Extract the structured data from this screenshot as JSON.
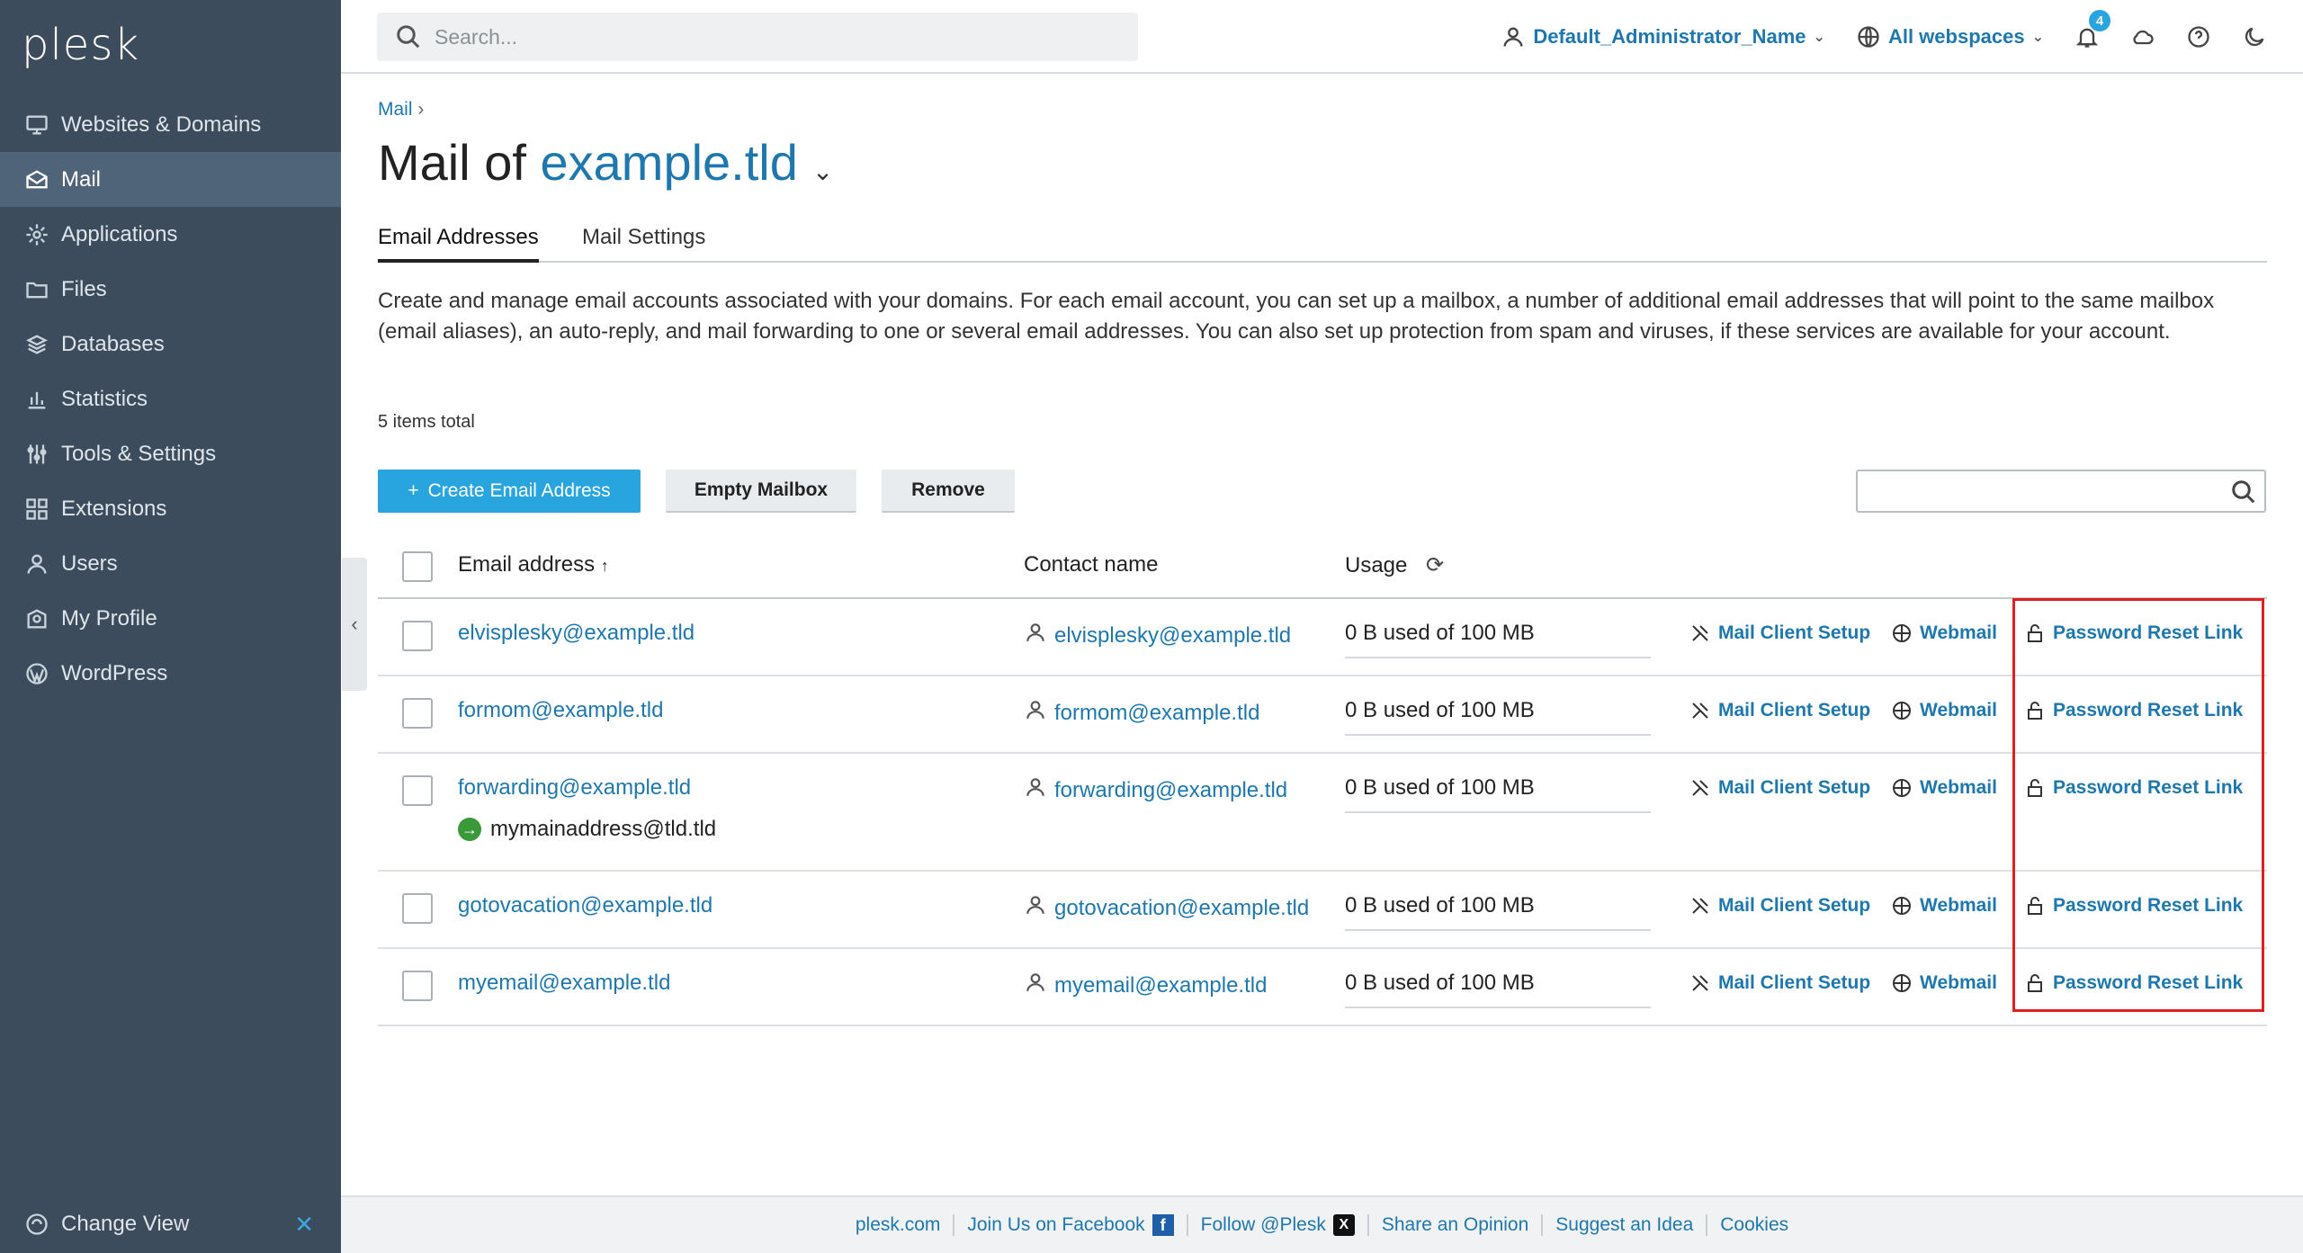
{
  "app": {
    "logo": "plesk"
  },
  "sidebar": {
    "items": [
      {
        "label": "Websites & Domains",
        "icon": "monitor-icon"
      },
      {
        "label": "Mail",
        "icon": "mail-icon"
      },
      {
        "label": "Applications",
        "icon": "gear-icon"
      },
      {
        "label": "Files",
        "icon": "folder-icon"
      },
      {
        "label": "Databases",
        "icon": "database-icon"
      },
      {
        "label": "Statistics",
        "icon": "bar-chart-icon"
      },
      {
        "label": "Tools & Settings",
        "icon": "tools-icon"
      },
      {
        "label": "Extensions",
        "icon": "extensions-icon"
      },
      {
        "label": "Users",
        "icon": "user-icon"
      },
      {
        "label": "My Profile",
        "icon": "profile-icon"
      },
      {
        "label": "WordPress",
        "icon": "wordpress-icon"
      }
    ],
    "active_index": 1,
    "change_view": "Change View"
  },
  "topbar": {
    "search_placeholder": "Search...",
    "user_name": "Default_Administrator_Name",
    "webspaces": "All webspaces",
    "notification_count": "4"
  },
  "breadcrumb": "Mail",
  "title": {
    "prefix": "Mail of ",
    "domain": "example.tld"
  },
  "tabs": [
    "Email Addresses",
    "Mail Settings"
  ],
  "description": "Create and manage email accounts associated with your domains. For each email account, you can set up a mailbox, a number of additional email addresses that will point to the same mailbox (email aliases), an auto-reply, and mail forwarding to one or several email addresses. You can also set up protection from spam and viruses, if these services are available for your account.",
  "items_total": "5 items total",
  "buttons": {
    "create": "Create Email Address",
    "empty": "Empty Mailbox",
    "remove": "Remove"
  },
  "table": {
    "headers": {
      "email": "Email address",
      "contact": "Contact name",
      "usage": "Usage"
    },
    "actions": {
      "setup": "Mail Client Setup",
      "webmail": "Webmail",
      "reset": "Password Reset Link"
    },
    "rows": [
      {
        "email": "elvisplesky@example.tld",
        "contact": "elvisplesky@example.tld",
        "usage": "0 B used of 100 MB"
      },
      {
        "email": "formom@example.tld",
        "contact": "formom@example.tld",
        "usage": "0 B used of 100 MB"
      },
      {
        "email": "forwarding@example.tld",
        "contact": "forwarding@example.tld",
        "usage": "0 B used of 100 MB",
        "forward_to": "mymainaddress@tld.tld"
      },
      {
        "email": "gotovacation@example.tld",
        "contact": "gotovacation@example.tld",
        "usage": "0 B used of 100 MB"
      },
      {
        "email": "myemail@example.tld",
        "contact": "myemail@example.tld",
        "usage": "0 B used of 100 MB"
      }
    ]
  },
  "footer": [
    "plesk.com",
    "Join Us on Facebook",
    "Follow @Plesk",
    "Share an Opinion",
    "Suggest an Idea",
    "Cookies"
  ],
  "colors": {
    "sidebar": "#3d4c5d",
    "accent": "#28a4de",
    "link": "#1e78ad",
    "highlight": "#e02020"
  }
}
